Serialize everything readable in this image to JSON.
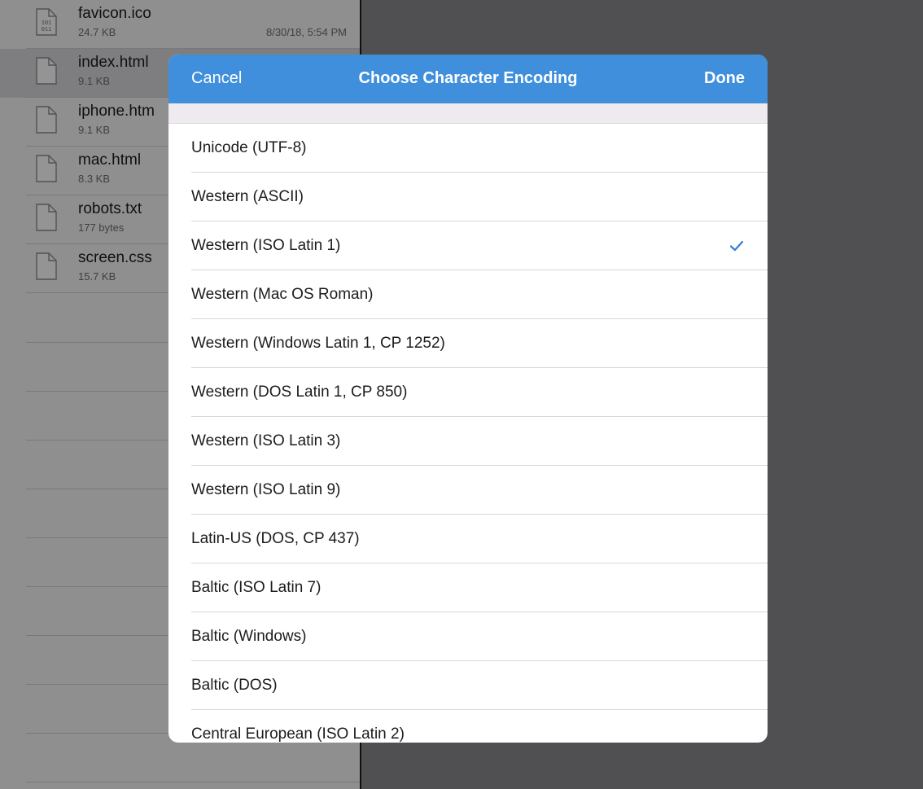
{
  "files": [
    {
      "name": "favicon.ico",
      "size": "24.7 KB",
      "date": "8/30/18, 5:54 PM",
      "icon": "binary-file-icon",
      "selected": false
    },
    {
      "name": "index.html",
      "size": "9.1 KB",
      "date": "",
      "icon": "document-icon",
      "selected": true
    },
    {
      "name": "iphone.htm",
      "size": "9.1 KB",
      "date": "",
      "icon": "document-icon",
      "selected": false
    },
    {
      "name": "mac.html",
      "size": "8.3 KB",
      "date": "",
      "icon": "document-icon",
      "selected": false
    },
    {
      "name": "robots.txt",
      "size": "177 bytes",
      "date": "",
      "icon": "document-icon",
      "selected": false
    },
    {
      "name": "screen.css",
      "size": "15.7 KB",
      "date": "",
      "icon": "document-icon",
      "selected": false
    }
  ],
  "modal": {
    "cancel_label": "Cancel",
    "title": "Choose Character Encoding",
    "done_label": "Done",
    "selected_encoding": "Western (ISO Latin 1)",
    "encodings": [
      "Unicode (UTF-8)",
      "Western (ASCII)",
      "Western (ISO Latin 1)",
      "Western (Mac OS Roman)",
      "Western (Windows Latin 1, CP 1252)",
      "Western (DOS Latin 1, CP 850)",
      "Western (ISO Latin 3)",
      "Western (ISO Latin 9)",
      "Latin-US (DOS, CP 437)",
      "Baltic (ISO Latin 7)",
      "Baltic (Windows)",
      "Baltic (DOS)",
      "Central European (ISO Latin 2)"
    ]
  },
  "colors": {
    "accent": "#3f8fdc",
    "checkmark": "#2f7fd6"
  }
}
